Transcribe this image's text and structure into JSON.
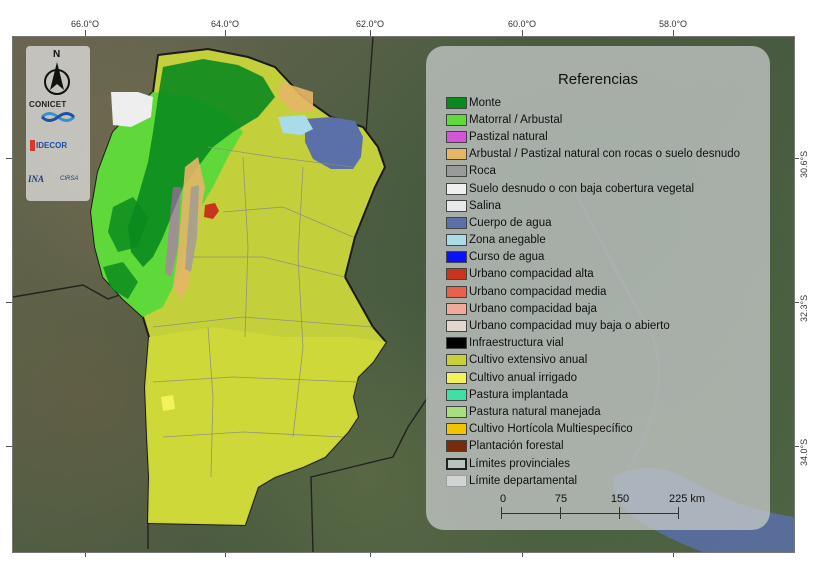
{
  "map": {
    "grid_top": [
      "66.0°O",
      "64.0°O",
      "62.0°O",
      "60.0°O",
      "58.0°O"
    ],
    "grid_right": [
      "30.6°S",
      "32.3°S",
      "34.0°S"
    ]
  },
  "logos": {
    "north": "N",
    "north_icon": "north-arrow-icon",
    "conicet": "CONICET",
    "idecor": "IDECOR",
    "ina": "INA",
    "cirsa": "CIRSA"
  },
  "legend": {
    "title": "Referencias",
    "items": [
      {
        "label": "Monte",
        "color": "#0a8a1e"
      },
      {
        "label": "Matorral / Arbustal",
        "color": "#5fd93a"
      },
      {
        "label": "Pastizal natural",
        "color": "#d156d8"
      },
      {
        "label": "Arbustal / Pastizal natural con rocas o suelo desnudo",
        "color": "#e6b567"
      },
      {
        "label": "Roca",
        "color": "#9a9a9a"
      },
      {
        "label": "Suelo desnudo o con baja cobertura vegetal",
        "color": "#f0f0f0"
      },
      {
        "label": "Salina",
        "color": "#e8e8e8"
      },
      {
        "label": "Cuerpo de agua",
        "color": "#5b6fa8"
      },
      {
        "label": "Zona anegable",
        "color": "#a9dbea"
      },
      {
        "label": "Curso de agua",
        "color": "#0b12f5"
      },
      {
        "label": "Urbano compacidad alta",
        "color": "#c8341c"
      },
      {
        "label": "Urbano compacidad media",
        "color": "#e8614b"
      },
      {
        "label": "Urbano compacidad baja",
        "color": "#f2a89a"
      },
      {
        "label": "Urbano compacidad muy baja o abierto",
        "color": "#e3d6cf"
      },
      {
        "label": "Infraestructura vial",
        "color": "#000000"
      },
      {
        "label": "Cultivo extensivo anual",
        "color": "#c9cf37"
      },
      {
        "label": "Cultivo anual irrigado",
        "color": "#f2f25a"
      },
      {
        "label": "Pastura implantada",
        "color": "#3fe0a6"
      },
      {
        "label": "Pastura natural manejada",
        "color": "#a6e07d"
      },
      {
        "label": "Cultivo Hortícola Multiespecífico",
        "color": "#f2c400"
      },
      {
        "label": "Plantación forestal",
        "color": "#7a2a0a"
      },
      {
        "label": "Límites provinciales",
        "color": "#b9c4bd"
      },
      {
        "label": "Límite departamental",
        "color": "#d0d4d2"
      }
    ],
    "scale": {
      "ticks": [
        "0",
        "75",
        "150",
        "225 km"
      ]
    }
  },
  "colors": {
    "province_fill": "#c4cf3c",
    "forest": "#0a8a1e",
    "shrub": "#5fd93a",
    "water": "#5b6fa8",
    "border": "#1b1b1b"
  }
}
